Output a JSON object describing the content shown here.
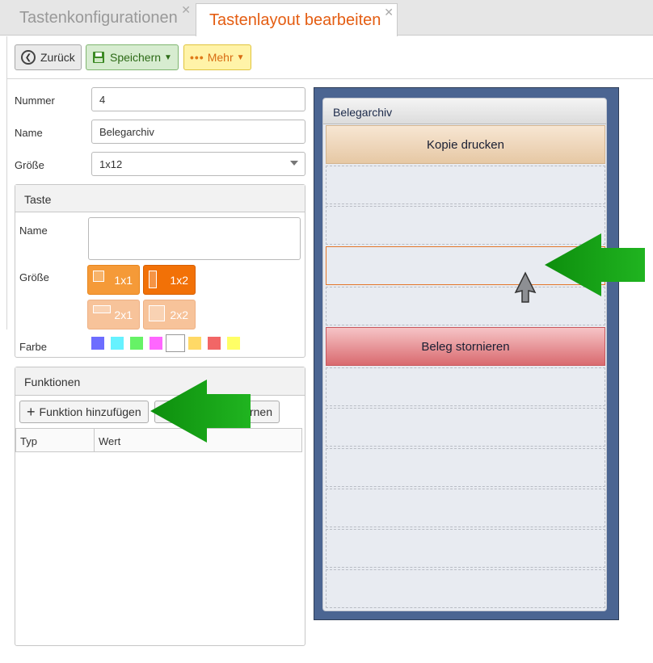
{
  "tabs": [
    {
      "label": "Tastenkonfigurationen"
    },
    {
      "label": "Tastenlayout bearbeiten"
    }
  ],
  "toolbar": {
    "back_label": "Zurück",
    "save_label": "Speichern",
    "more_label": "Mehr"
  },
  "form": {
    "number_label": "Nummer",
    "number_value": "4",
    "name_label": "Name",
    "name_value": "Belegarchiv",
    "size_label": "Größe",
    "size_value": "1x12"
  },
  "key_panel": {
    "title": "Taste",
    "name_label": "Name",
    "name_value": "",
    "size_label": "Größe",
    "sizes": [
      "1x1",
      "1x2",
      "2x1",
      "2x2"
    ],
    "color_label": "Farbe",
    "colors": [
      "#6d6dff",
      "#66f2ff",
      "#66f266",
      "#ff66ff",
      "#ffffff",
      "#ffd966",
      "#f26666",
      "#ffff66"
    ]
  },
  "functions_panel": {
    "title": "Funktionen",
    "add_label": "Funktion hinzufügen",
    "remove_label_partial": "rnen",
    "col_type": "Typ",
    "col_value": "Wert"
  },
  "preview": {
    "title": "Belegarchiv",
    "key_copy": "Kopie drucken",
    "key_cancel": "Beleg stornieren"
  }
}
